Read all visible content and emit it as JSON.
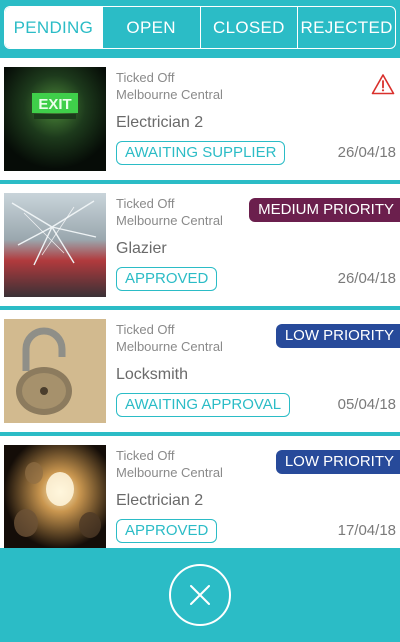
{
  "tabs": [
    "PENDING",
    "OPEN",
    "CLOSED",
    "REJECTED"
  ],
  "active_tab": "PENDING",
  "jobs": [
    {
      "site": "Ticked Off",
      "location": "Melbourne Central",
      "trade": "Electrician 2",
      "status": "AWAITING SUPPLIER",
      "date": "26/04/18",
      "priority": "",
      "warning": true,
      "photo": "exit-sign"
    },
    {
      "site": "Ticked Off",
      "location": "Melbourne Central",
      "trade": "Glazier",
      "status": "APPROVED",
      "date": "26/04/18",
      "priority": "MEDIUM PRIORITY",
      "priority_color": "#6b1f4d",
      "photo": "broken-glass"
    },
    {
      "site": "Ticked Off",
      "location": "Melbourne Central",
      "trade": "Locksmith",
      "status": "AWAITING APPROVAL",
      "date": "05/04/18",
      "priority": "LOW PRIORITY",
      "priority_color": "#274a9a",
      "photo": "padlock"
    },
    {
      "site": "Ticked Off",
      "location": "Melbourne Central",
      "trade": "Electrician 2",
      "status": "APPROVED",
      "date": "17/04/18",
      "priority": "LOW PRIORITY",
      "priority_color": "#274a9a",
      "photo": "light-bulbs"
    }
  ],
  "colors": {
    "accent": "#2bbcc6",
    "warning": "#d9302c"
  },
  "icons": {
    "warning": "warning-triangle-icon",
    "close": "close-icon"
  }
}
